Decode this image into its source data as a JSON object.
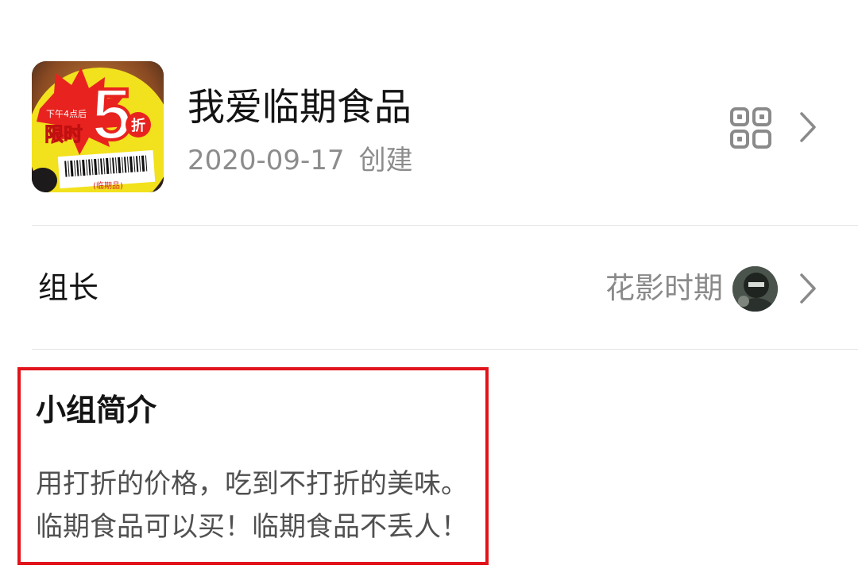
{
  "group": {
    "name": "我爱临期食品",
    "created_date": "2020-09-17",
    "created_suffix": "创建",
    "cover_image": {
      "line_top": "下午4点后",
      "line_mid": "限时",
      "big_number": "5",
      "discount_char": "折",
      "tag": "(临期品)"
    },
    "icons": {
      "qr": "qr-code-icon",
      "chevron": "chevron-right-icon"
    }
  },
  "owner": {
    "label": "组长",
    "name": "花影时期",
    "avatar": "owner-avatar"
  },
  "intro": {
    "title": "小组简介",
    "lines": [
      "用打折的价格，吃到不打折的美味。",
      "临期食品可以买！临期食品不丢人！"
    ]
  },
  "colors": {
    "highlight_border": "#e0141a",
    "divider": "#e6e6e6",
    "secondary_text": "#8c8c8c"
  }
}
